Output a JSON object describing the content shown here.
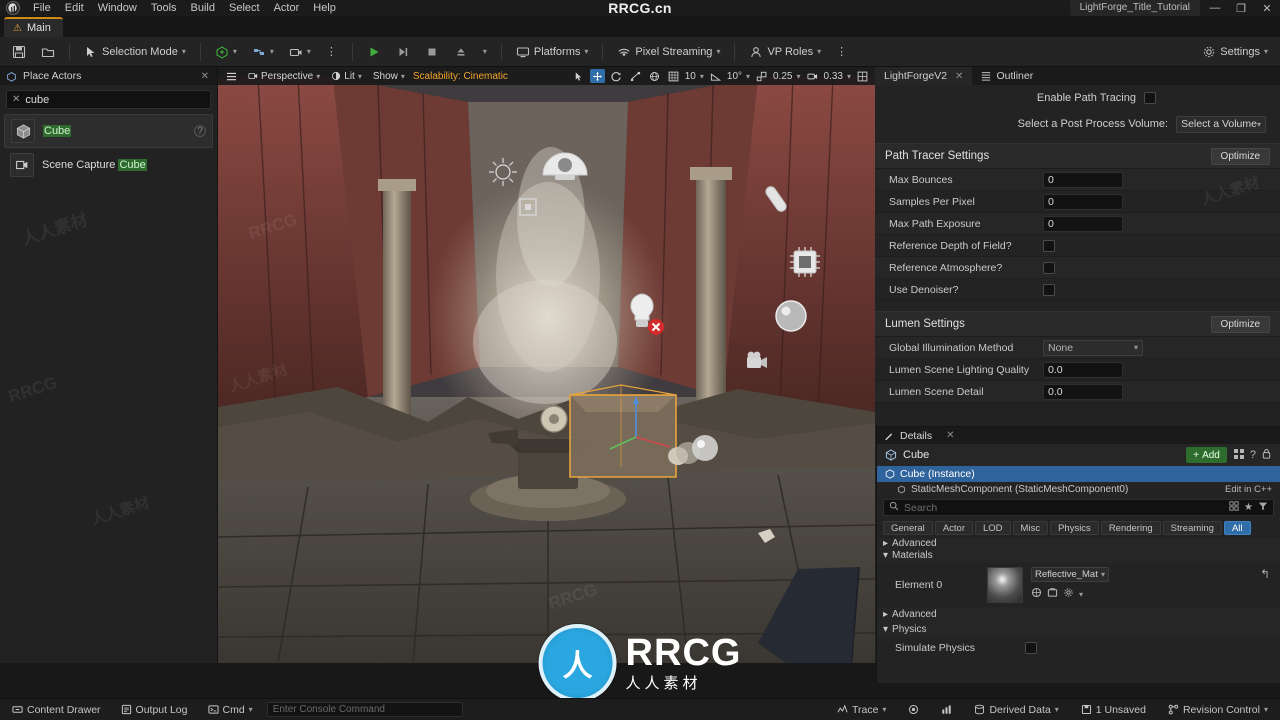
{
  "window": {
    "center_watermark": "RRCG.cn",
    "project_tab": "LightForge_Title_Tutorial",
    "minimize": "—",
    "maximize": "❐",
    "close": "✕"
  },
  "menu": {
    "items": [
      "File",
      "Edit",
      "Window",
      "Tools",
      "Build",
      "Select",
      "Actor",
      "Help"
    ]
  },
  "tabs": {
    "main_label": "Main",
    "main_warn_icon": "warning-icon"
  },
  "toolbar": {
    "save_icon": "save-icon",
    "browse_icon": "content-browser-icon",
    "selection_mode": "Selection Mode",
    "create_icon": "add-actor-icon",
    "blueprint_icon": "blueprints-icon",
    "cinematics_icon": "cinematics-icon",
    "more_icon": "ellipsis-icon",
    "play": "play-icon",
    "skip": "skip-icon",
    "stop": "stop-icon",
    "eject": "eject-icon",
    "platforms": "Platforms",
    "pixel_streaming": "Pixel Streaming",
    "vp_roles": "VP Roles",
    "settings": "Settings"
  },
  "place_actors": {
    "tab_label": "Place Actors",
    "close_icon": "close-icon",
    "search_value": "cube",
    "search_clear_icon": "clear-icon",
    "items": [
      {
        "name_prefix": "",
        "name_highlight": "Cube",
        "name_suffix": "",
        "icon": "cube-icon",
        "help": "?"
      },
      {
        "name_prefix": "Scene Capture ",
        "name_highlight": "Cube",
        "name_suffix": "",
        "icon": "scene-capture-cube-icon",
        "help": ""
      }
    ]
  },
  "viewport": {
    "menu_icon": "viewport-menu-icon",
    "perspective": "Perspective",
    "lit": "Lit",
    "show": "Show",
    "scalability": "Scalability: Cinematic",
    "select_icon": "select-tool-icon",
    "move_icon": "move-tool-icon",
    "rotate_icon": "rotate-tool-icon",
    "scale_icon": "scale-tool-icon",
    "world_icon": "world-coords-icon",
    "grid_snap_value": "10",
    "rotation_snap_value": "10°",
    "scale_snap_value": "0.25",
    "camera_speed_value": "0.33",
    "layout_icon": "viewport-layout-icon"
  },
  "lightforge": {
    "tab_label": "LightForgeV2",
    "tab_close_icon": "close-icon",
    "outliner_tab": "Outliner",
    "enable_path_tracing_label": "Enable Path Tracing",
    "post_process_label": "Select a Post Process Volume:",
    "post_process_value": "Select a Volume",
    "path_tracer_title": "Path Tracer Settings",
    "optimize_label": "Optimize",
    "path_tracer_rows": [
      {
        "label": "Max Bounces",
        "value": "0",
        "type": "number"
      },
      {
        "label": "Samples Per Pixel",
        "value": "0",
        "type": "number"
      },
      {
        "label": "Max Path Exposure",
        "value": "0",
        "type": "number"
      },
      {
        "label": "Reference Depth of Field?",
        "value": "",
        "type": "check"
      },
      {
        "label": "Reference Atmosphere?",
        "value": "",
        "type": "check"
      },
      {
        "label": "Use Denoiser?",
        "value": "",
        "type": "check"
      }
    ],
    "lumen_title": "Lumen Settings",
    "lumen_rows": [
      {
        "label": "Global Illumination Method",
        "value": "None",
        "type": "combo"
      },
      {
        "label": "Lumen Scene Lighting Quality",
        "value": "0.0",
        "type": "number"
      },
      {
        "label": "Lumen Scene Detail",
        "value": "0.0",
        "type": "number"
      }
    ]
  },
  "details": {
    "tab_label": "Details",
    "tab_close_icon": "close-icon",
    "actor_name": "Cube",
    "actor_icon": "actor-icon",
    "add_label": "Add",
    "add_icon": "plus-icon",
    "grid_icon": "grid-icon",
    "help_icon": "help-icon",
    "lock_icon": "lock-icon",
    "component_row": "Cube (Instance)",
    "component_sub": "StaticMeshComponent (StaticMeshComponent0)",
    "edit_in_cpp": "Edit in C++",
    "search_placeholder": "Search",
    "search_icon": "search-icon",
    "filter_icons": [
      "settings-grid-icon",
      "star-icon",
      "filter-icon"
    ],
    "filters": [
      "General",
      "Actor",
      "LOD",
      "Misc",
      "Physics",
      "Rendering",
      "Streaming",
      "All"
    ],
    "active_filter": "All",
    "advanced_top": "Advanced",
    "materials_section": "Materials",
    "element_label": "Element 0",
    "material_name": "Reflective_Mat",
    "advanced_section": "Advanced",
    "physics_section": "Physics",
    "simulate_physics_label": "Simulate Physics",
    "reset_icon": "reset-arrow-icon"
  },
  "statusbar": {
    "content_drawer": "Content Drawer",
    "content_drawer_icon": "drawer-icon",
    "output_log": "Output Log",
    "output_log_icon": "log-icon",
    "cmd": "Cmd",
    "cmd_icon": "cmd-icon",
    "console_placeholder": "Enter Console Command",
    "trace": "Trace",
    "trace_icon": "trace-icon",
    "record_icon": "record-icon",
    "stats_icon": "stats-icon",
    "derived_data": "Derived Data",
    "derived_icon": "derived-data-icon",
    "unsaved": "1 Unsaved",
    "unsaved_icon": "unsaved-icon",
    "revision_control": "Revision Control",
    "revision_icon": "revision-icon"
  },
  "watermarks": {
    "brand_main": "RRCG",
    "brand_sub": "人人素材",
    "tile": "人人素材"
  },
  "colors": {
    "accent_orange": "#d08a17",
    "accent_blue": "#2f6ea8",
    "add_green": "#2f6d2f",
    "highlight_green": "#2f6b2f",
    "scalability": "#f0a52a"
  }
}
